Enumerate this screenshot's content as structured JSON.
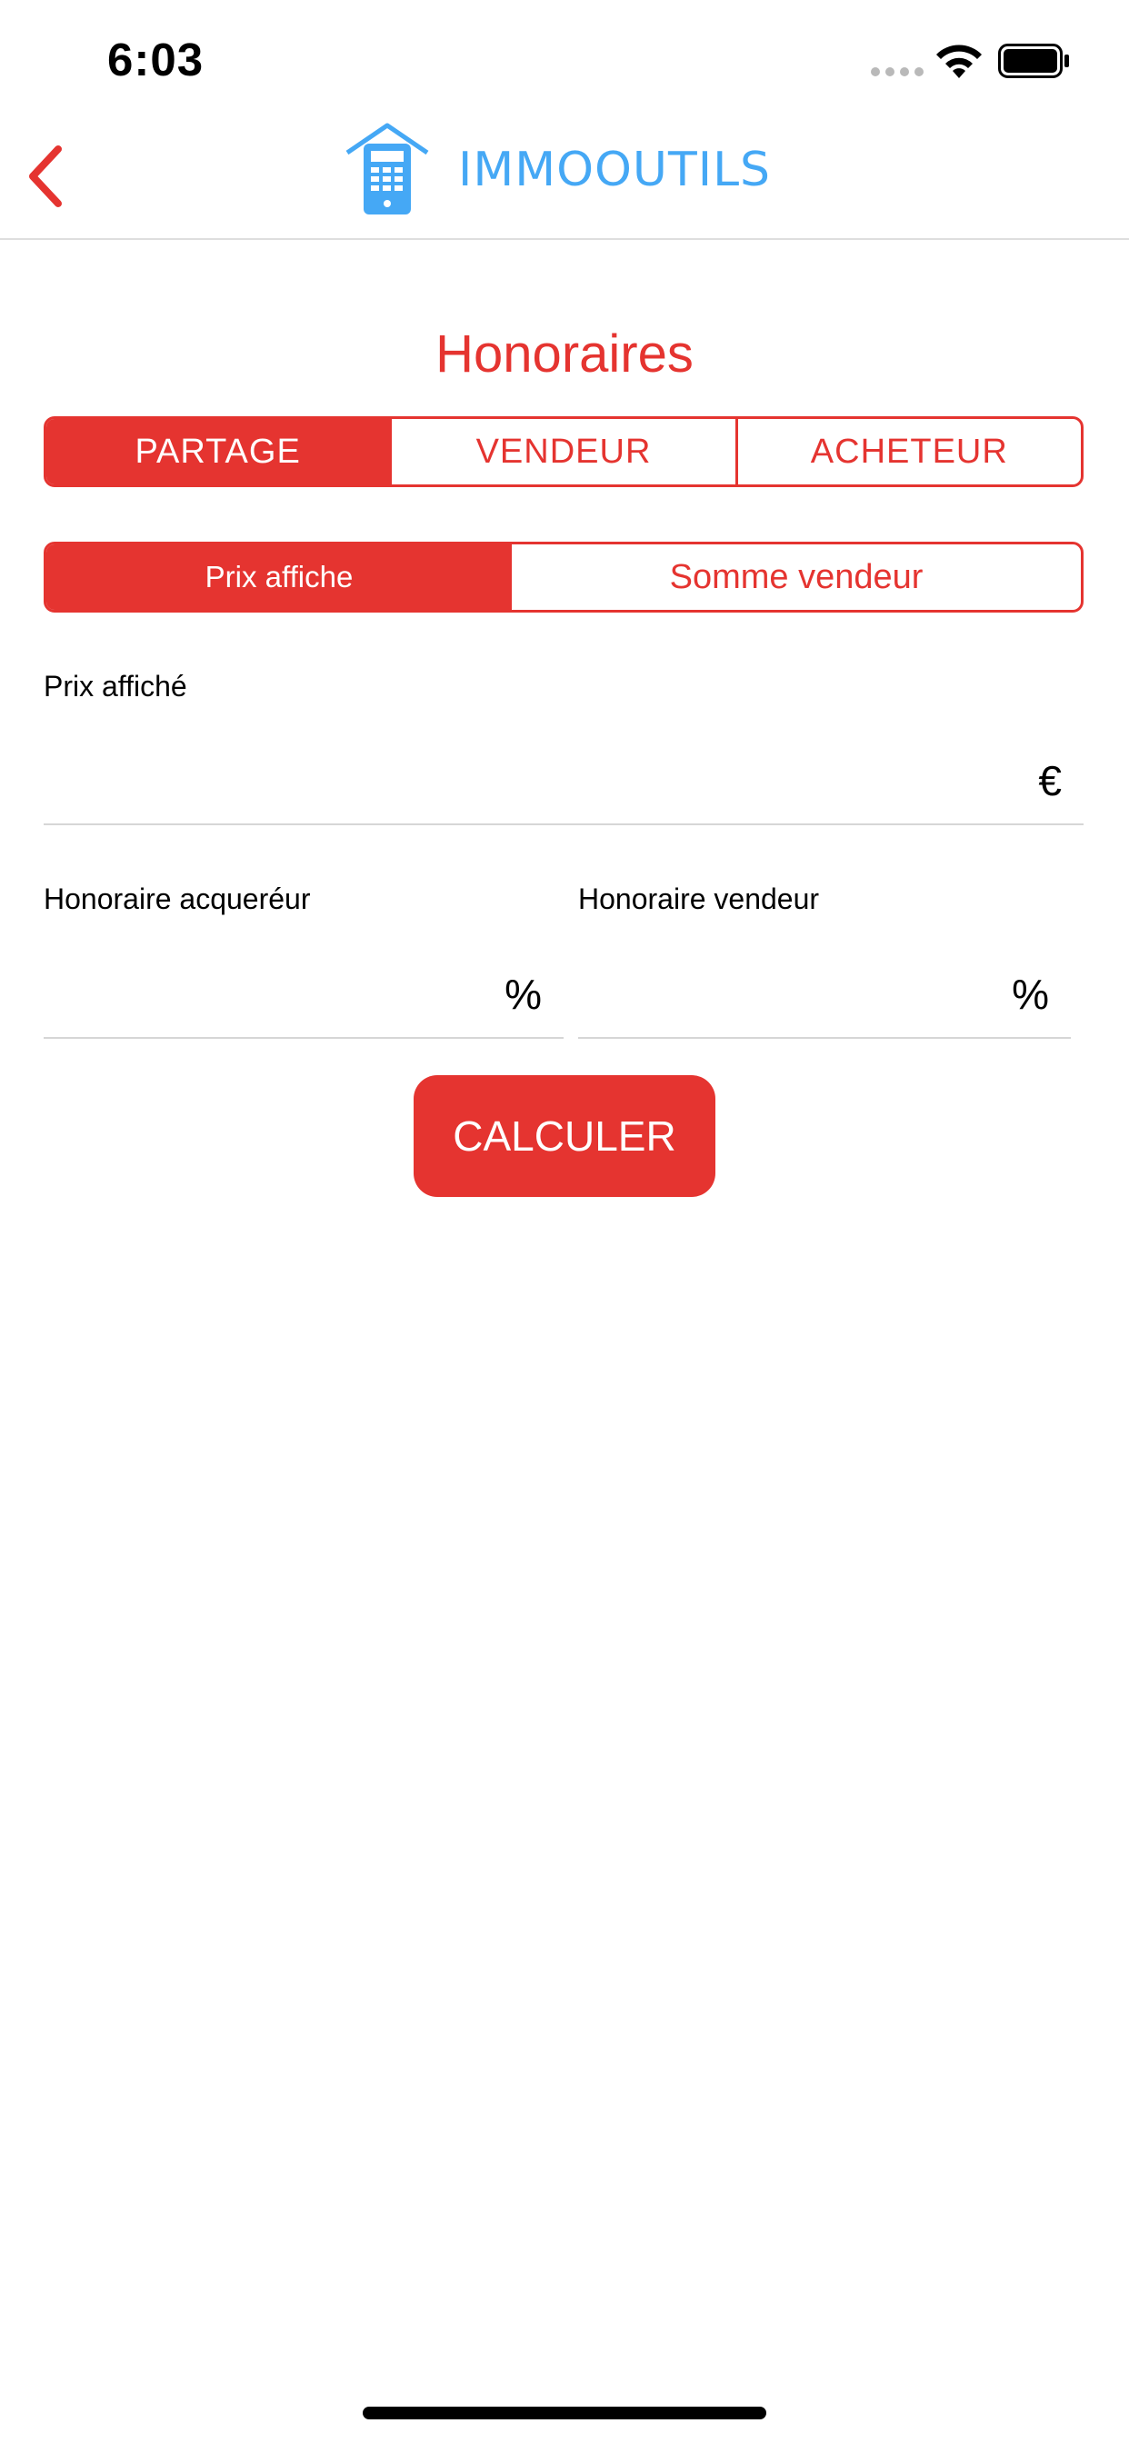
{
  "status_bar": {
    "time": "6:03"
  },
  "nav": {
    "logo_text": "IMMOOUTILS"
  },
  "page": {
    "title": "Honoraires"
  },
  "tabs": [
    {
      "label": "PARTAGE",
      "active": true
    },
    {
      "label": "VENDEUR",
      "active": false
    },
    {
      "label": "ACHETEUR",
      "active": false
    }
  ],
  "mode": [
    {
      "label": "Prix affiche",
      "active": true
    },
    {
      "label": "Somme vendeur",
      "active": false
    }
  ],
  "fields": {
    "prix": {
      "label": "Prix affiché",
      "value": "",
      "unit": "€"
    },
    "acquereur": {
      "label": "Honoraire acqueréur",
      "value": "",
      "unit": "%"
    },
    "vendeur": {
      "label": "Honoraire vendeur",
      "value": "",
      "unit": "%"
    }
  },
  "actions": {
    "calculate_label": "CALCULER"
  },
  "colors": {
    "accent": "#e53430",
    "logo": "#45a8f5"
  },
  "icons": {
    "back": "chevron-left-icon",
    "logo": "house-calculator-icon"
  }
}
